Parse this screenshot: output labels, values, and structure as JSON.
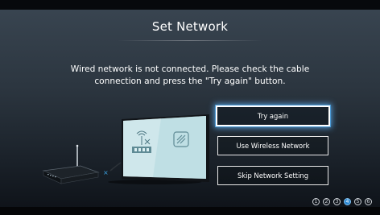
{
  "title": "Set Network",
  "message": {
    "line1": "Wired network is not connected. Please check the cable",
    "line2": "connection and press the \"Try again\" button."
  },
  "buttons": {
    "try_again": "Try again",
    "wireless": "Use Wireless Network",
    "skip": "Skip Network Setting"
  },
  "illustration": {
    "status_marker": "×"
  },
  "steps": [
    {
      "label": "1",
      "active": false
    },
    {
      "label": "2",
      "active": false
    },
    {
      "label": "3",
      "active": false
    },
    {
      "label": "4",
      "active": true
    },
    {
      "label": "5",
      "active": false
    },
    {
      "label": "6",
      "active": false
    }
  ],
  "colors": {
    "focus_glow": "#4c9bd6",
    "active_step": "#2a86d0",
    "error_marker": "#3aa0e0"
  }
}
